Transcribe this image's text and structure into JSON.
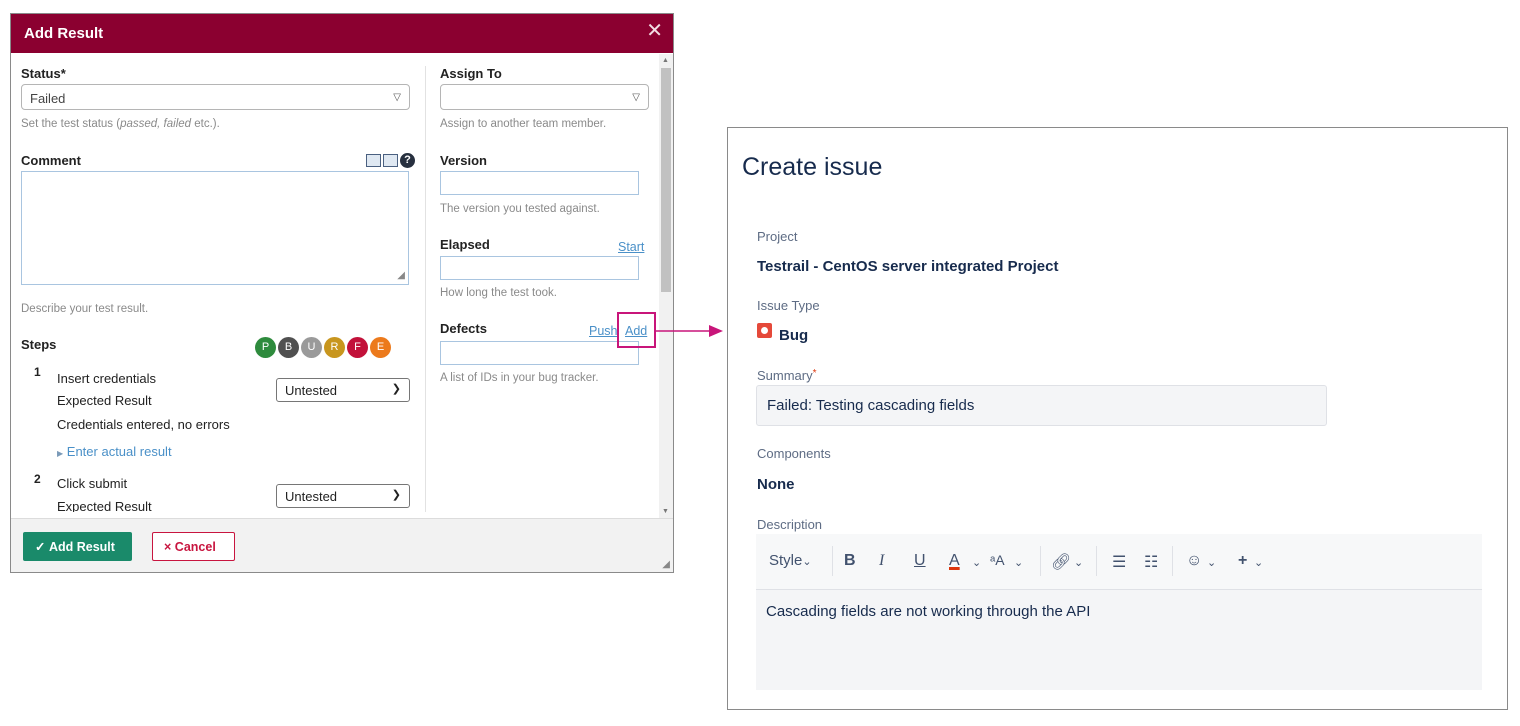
{
  "dialog": {
    "title": "Add Result",
    "status": {
      "label": "Status",
      "required_mark": "*",
      "value": "Failed"
    },
    "status_hint_prefix": "Set the test status (",
    "status_hint_italic": "passed, failed",
    "status_hint_suffix": " etc.).",
    "comment": {
      "label": "Comment",
      "hint": "Describe your test result."
    },
    "assign_to": {
      "label": "Assign To",
      "value": "",
      "hint": "Assign to another team member."
    },
    "version": {
      "label": "Version",
      "value": "",
      "hint": "The version you tested against."
    },
    "elapsed": {
      "label": "Elapsed",
      "start_link": "Start",
      "value": "",
      "hint": "How long the test took."
    },
    "defects": {
      "label": "Defects",
      "push_link": "Push",
      "add_link": "Add",
      "value": "",
      "hint": "A list of IDs in your bug tracker."
    },
    "steps": {
      "label": "Steps",
      "badges": [
        {
          "letter": "P",
          "color": "#2e8b3d"
        },
        {
          "letter": "B",
          "color": "#505050"
        },
        {
          "letter": "U",
          "color": "#9a9a9a"
        },
        {
          "letter": "R",
          "color": "#c8961e"
        },
        {
          "letter": "F",
          "color": "#c2113a"
        },
        {
          "letter": "E",
          "color": "#ec7a1c"
        }
      ],
      "items": [
        {
          "number": "1",
          "text": "Insert credentials",
          "expected_label": "Expected Result",
          "expected": "Credentials entered, no errors",
          "actual_link": "Enter actual result",
          "status": "Untested"
        },
        {
          "number": "2",
          "text": "Click submit",
          "expected_label": "Expected Result",
          "status": "Untested"
        }
      ]
    },
    "buttons": {
      "add": "Add Result",
      "cancel": "Cancel"
    },
    "colors": {
      "header": "#8b0030",
      "add_button": "#1a8a6a",
      "cancel": "#c8153f",
      "highlight": "#c8157a"
    }
  },
  "issue": {
    "title": "Create issue",
    "project": {
      "label": "Project",
      "value": "Testrail - CentOS server integrated Project"
    },
    "issue_type": {
      "label": "Issue Type",
      "value": "Bug"
    },
    "summary": {
      "label": "Summary",
      "required_mark": "*",
      "value": "Failed: Testing cascading fields"
    },
    "components": {
      "label": "Components",
      "value": "None"
    },
    "description": {
      "label": "Description",
      "toolbar": {
        "style": "Style",
        "bold": "B",
        "italic": "I",
        "underline": "U",
        "color": "A",
        "more_text": "ᵃA"
      },
      "value": "Cascading fields are not working through the API"
    }
  }
}
